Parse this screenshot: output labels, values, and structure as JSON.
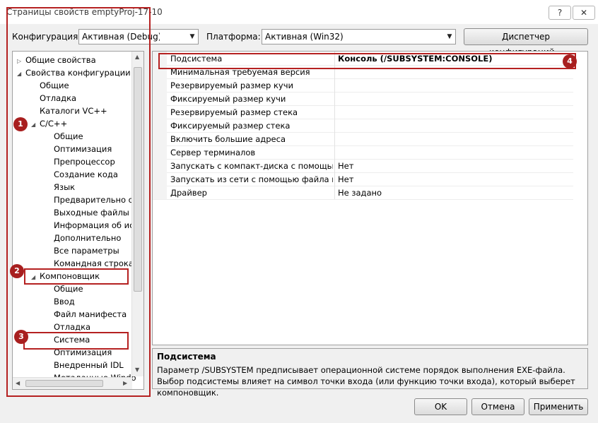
{
  "window": {
    "title": "Страницы свойств emptyProj-17-10",
    "help_button": "?",
    "close_button": "✕"
  },
  "toolbar": {
    "config_label": "Конфигурация:",
    "config_value": "Активная (Debug)",
    "platform_label": "Платформа:",
    "platform_value": "Активная (Win32)",
    "config_manager_button": "Диспетчер конфигураций..."
  },
  "tree": {
    "items": [
      {
        "label": "Общие свойства",
        "expander": "▷"
      },
      {
        "label": "Свойства конфигурации",
        "expander": "◢"
      },
      {
        "label": "Общие",
        "expander": ""
      },
      {
        "label": "Отладка",
        "expander": ""
      },
      {
        "label": "Каталоги VC++",
        "expander": ""
      },
      {
        "label": "C/C++",
        "expander": "◢"
      },
      {
        "label": "Общие",
        "expander": ""
      },
      {
        "label": "Оптимизация",
        "expander": ""
      },
      {
        "label": "Препроцессор",
        "expander": ""
      },
      {
        "label": "Создание кода",
        "expander": ""
      },
      {
        "label": "Язык",
        "expander": ""
      },
      {
        "label": "Предварительно от",
        "expander": ""
      },
      {
        "label": "Выходные файлы",
        "expander": ""
      },
      {
        "label": "Информация об ис",
        "expander": ""
      },
      {
        "label": "Дополнительно",
        "expander": ""
      },
      {
        "label": "Все параметры",
        "expander": ""
      },
      {
        "label": "Командная строка",
        "expander": ""
      },
      {
        "label": "Компоновщик",
        "expander": "◢"
      },
      {
        "label": "Общие",
        "expander": ""
      },
      {
        "label": "Ввод",
        "expander": ""
      },
      {
        "label": "Файл манифеста",
        "expander": ""
      },
      {
        "label": "Отладка",
        "expander": ""
      },
      {
        "label": "Система",
        "expander": ""
      },
      {
        "label": "Оптимизация",
        "expander": ""
      },
      {
        "label": "Внедренный IDL",
        "expander": ""
      },
      {
        "label": "Метаданные Windo",
        "expander": ""
      }
    ]
  },
  "grid": {
    "rows": [
      {
        "name": "Подсистема",
        "value": "Консоль (/SUBSYSTEM:CONSOLE)"
      },
      {
        "name": "Минимальная требуемая версия",
        "value": ""
      },
      {
        "name": "Резервируемый размер кучи",
        "value": ""
      },
      {
        "name": "Фиксируемый размер кучи",
        "value": ""
      },
      {
        "name": "Резервируемый размер стека",
        "value": ""
      },
      {
        "name": "Фиксируемый размер стека",
        "value": ""
      },
      {
        "name": "Включить большие адреса",
        "value": ""
      },
      {
        "name": "Сервер терминалов",
        "value": ""
      },
      {
        "name": "Запускать с компакт-диска с помощью ф",
        "value": "Нет"
      },
      {
        "name": "Запускать из сети с помощью файла подк",
        "value": "Нет"
      },
      {
        "name": "Драйвер",
        "value": "Не задано"
      }
    ]
  },
  "description": {
    "title": "Подсистема",
    "text": "Параметр /SUBSYSTEM предписывает операционной системе порядок выполнения EXE-файла. Выбор подсистемы влияет на символ точки входа (или функцию точки входа), который выберет компоновщик."
  },
  "buttons": {
    "ok": "OK",
    "cancel": "Отмена",
    "apply": "Применить"
  },
  "annotations": {
    "badge1": "1",
    "badge2": "2",
    "badge3": "3",
    "badge4": "4",
    "color": "#b52121"
  }
}
